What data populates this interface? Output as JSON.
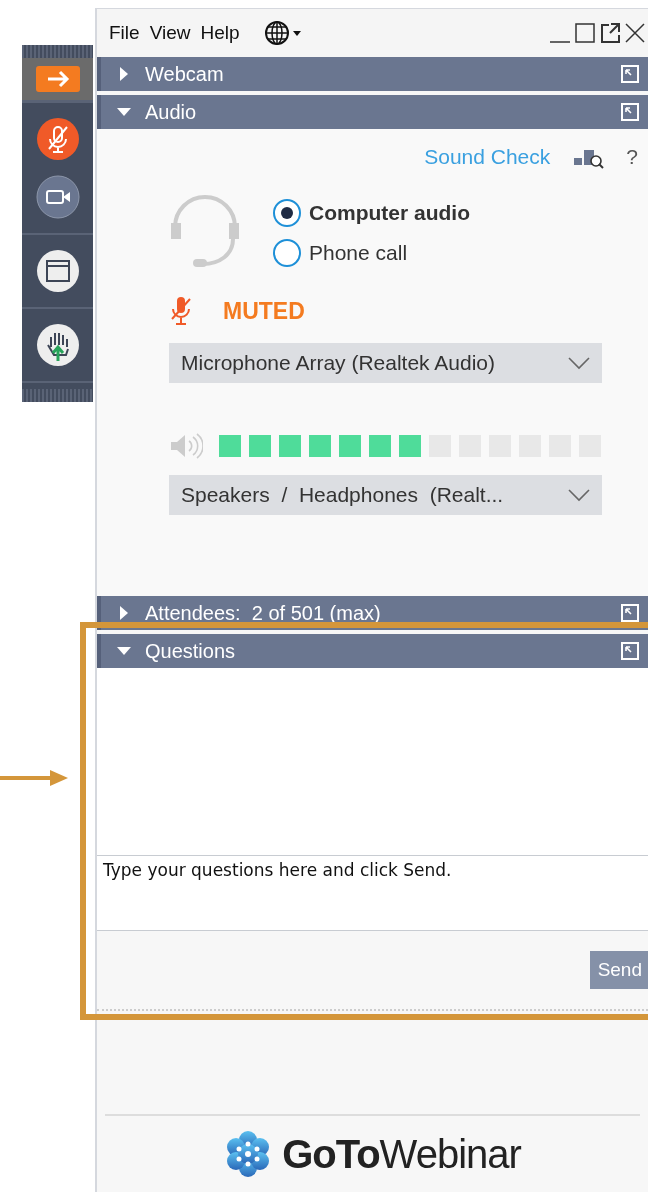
{
  "menu": [
    "File",
    "View",
    "Help"
  ],
  "sections": [
    {
      "kind": "webcam",
      "title": "Webcam",
      "expanded": false
    },
    {
      "kind": "audio",
      "title": "Audio",
      "expanded": true,
      "sound_check": "Sound Check",
      "help": "?",
      "options": [
        {
          "label": "Computer audio",
          "selected": true
        },
        {
          "label": "Phone call",
          "selected": false
        }
      ],
      "mute_status": "MUTED",
      "microphone": "Microphone Array (Realtek Audio)",
      "speaker_meter": {
        "level": 0.538
      },
      "speaker": "Speakers  /  Headphones  (Realt..."
    },
    {
      "kind": "attendees",
      "title": "Attendees:  2 of 501 (max)",
      "expanded": false
    },
    {
      "kind": "questions",
      "title": "Questions",
      "expanded": true,
      "placeholder": "Type your questions here and click Send.",
      "send": "Send"
    }
  ],
  "branding": "**GoTo**Webinar"
}
